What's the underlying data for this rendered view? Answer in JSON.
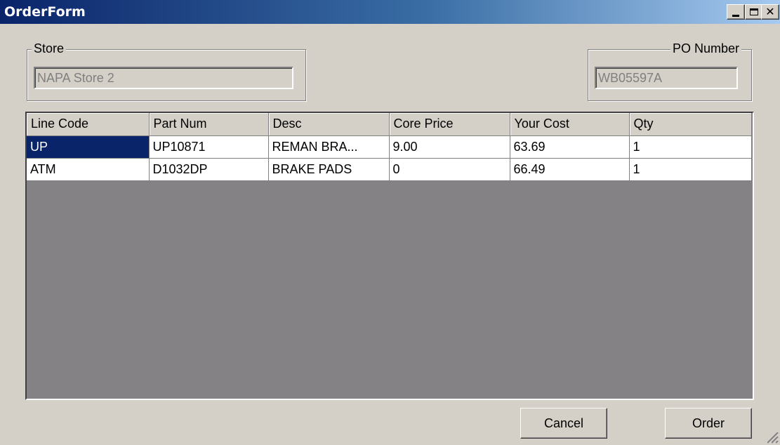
{
  "window": {
    "title": "OrderForm"
  },
  "store": {
    "label": "Store",
    "value": "NAPA Store 2"
  },
  "po": {
    "label": "PO Number",
    "value": "WB05597A"
  },
  "grid": {
    "columns": [
      "Line Code",
      "Part Num",
      "Desc",
      "Core Price",
      "Your Cost",
      "Qty"
    ],
    "rows": [
      [
        "UP",
        "UP10871",
        "REMAN BRA...",
        "9.00",
        "63.69",
        "1"
      ],
      [
        "ATM",
        "D1032DP",
        "BRAKE PADS",
        "0",
        "66.49",
        "1"
      ]
    ],
    "selected_cell": "UP"
  },
  "buttons": {
    "cancel": "Cancel",
    "order": "Order"
  },
  "titlebar_buttons": {
    "close": "✕"
  },
  "colors": {
    "title_start": "#0a246a",
    "title_end": "#a6caf0",
    "selection": "#0a246a",
    "grid_background": "#858285",
    "face": "#d4d0c8"
  }
}
